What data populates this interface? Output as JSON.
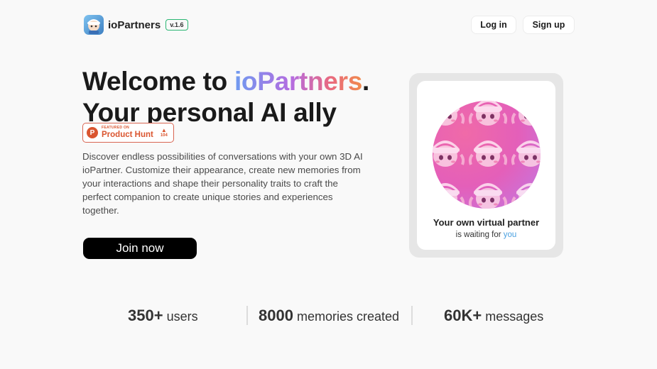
{
  "header": {
    "brand": "ioPartners",
    "version": "v.1.6",
    "login_label": "Log in",
    "signup_label": "Sign up"
  },
  "hero": {
    "title_prefix": "Welcome to ",
    "title_brand": "ioPartners",
    "title_dot": ".",
    "title_line2": "Your personal AI ally",
    "description": "Discover endless possibilities of conversations with your own 3D AI ioPartner. Customize their appearance, create new memories from your interactions and shape their personality traits to craft the perfect companion to create unique stories and experiences together.",
    "cta_label": "Join now"
  },
  "product_hunt": {
    "featured_text": "FEATURED ON",
    "name": "Product Hunt",
    "votes": "104",
    "logo_letter": "P"
  },
  "card": {
    "title": "Your own virtual partner",
    "subtitle_prefix": "is waiting for ",
    "subtitle_highlight": "you"
  },
  "stats": [
    {
      "number": "350+",
      "label": "users"
    },
    {
      "number": "8000",
      "label": "memories created"
    },
    {
      "number": "60K+",
      "label": "messages"
    }
  ],
  "colors": {
    "accent_green": "#2bb673",
    "product_hunt": "#da552f",
    "highlight_blue": "#4aa0e0",
    "avatar_pink": "#e45fb9"
  },
  "icons": [
    "app-logo-icon",
    "product-hunt-icon",
    "upvote-arrow-icon"
  ]
}
